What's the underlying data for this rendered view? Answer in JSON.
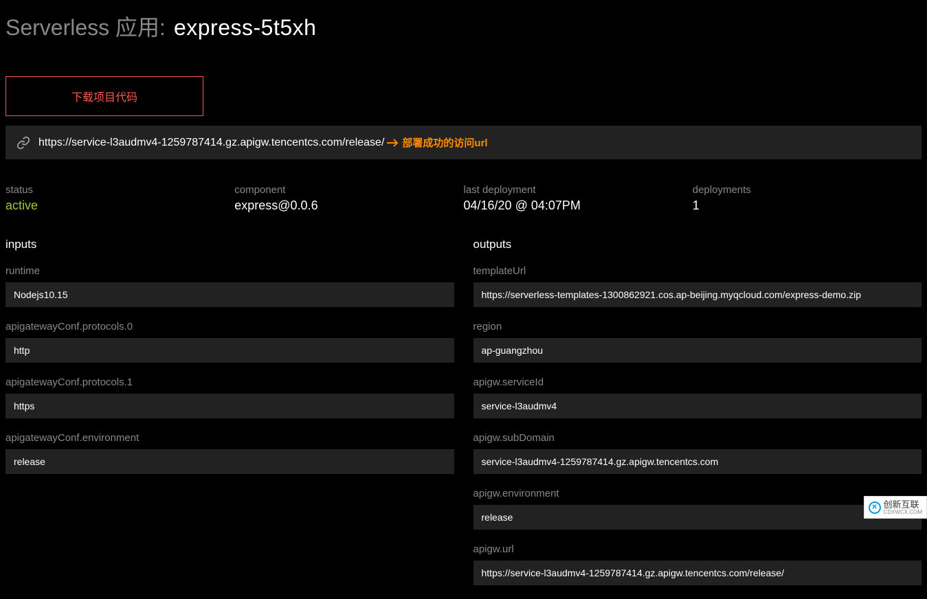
{
  "header": {
    "title_prefix": "Serverless 应用:",
    "title_name": "express-5t5xh",
    "download_button": "下载项目代码",
    "url": "https://service-l3audmv4-1259787414.gz.apigw.tencentcs.com/release/",
    "url_annotation": "部署成功的访问url"
  },
  "meta": {
    "status": {
      "label": "status",
      "value": "active"
    },
    "component": {
      "label": "component",
      "value": "express@0.0.6"
    },
    "last_deployment": {
      "label": "last deployment",
      "value": "04/16/20 @ 04:07PM"
    },
    "deployments": {
      "label": "deployments",
      "value": "1"
    }
  },
  "inputs": {
    "heading": "inputs",
    "items": [
      {
        "label": "runtime",
        "value": "Nodejs10.15"
      },
      {
        "label": "apigatewayConf.protocols.0",
        "value": "http"
      },
      {
        "label": "apigatewayConf.protocols.1",
        "value": "https"
      },
      {
        "label": "apigatewayConf.environment",
        "value": "release"
      }
    ]
  },
  "outputs": {
    "heading": "outputs",
    "items": [
      {
        "label": "templateUrl",
        "value": "https://serverless-templates-1300862921.cos.ap-beijing.myqcloud.com/express-demo.zip"
      },
      {
        "label": "region",
        "value": "ap-guangzhou"
      },
      {
        "label": "apigw.serviceId",
        "value": "service-l3audmv4"
      },
      {
        "label": "apigw.subDomain",
        "value": "service-l3audmv4-1259787414.gz.apigw.tencentcs.com"
      },
      {
        "label": "apigw.environment",
        "value": "release"
      },
      {
        "label": "apigw.url",
        "value": "https://service-l3audmv4-1259787414.gz.apigw.tencentcs.com/release/"
      }
    ]
  },
  "watermark": {
    "brand": "创新互联",
    "sub": "CDXWCX.COM"
  }
}
